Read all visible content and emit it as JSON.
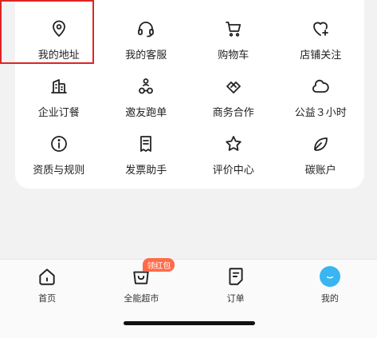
{
  "menu": {
    "items": [
      {
        "label": "我的地址",
        "icon": "location-pin-icon"
      },
      {
        "label": "我的客服",
        "icon": "headset-icon"
      },
      {
        "label": "购物车",
        "icon": "cart-icon"
      },
      {
        "label": "店铺关注",
        "icon": "heart-plus-icon"
      },
      {
        "label": "企业订餐",
        "icon": "building-icon"
      },
      {
        "label": "邀友跑单",
        "icon": "person-bike-icon"
      },
      {
        "label": "商务合作",
        "icon": "handshake-icon"
      },
      {
        "label": "公益３小时",
        "icon": "cloud-icon"
      },
      {
        "label": "资质与规则",
        "icon": "info-icon"
      },
      {
        "label": "发票助手",
        "icon": "receipt-icon"
      },
      {
        "label": "评价中心",
        "icon": "star-icon"
      },
      {
        "label": "碳账户",
        "icon": "leaf-icon"
      }
    ]
  },
  "tabbar": {
    "tabs": [
      {
        "label": "首页",
        "icon": "home-icon"
      },
      {
        "label": "全能超市",
        "icon": "shopping-bag-icon",
        "badge": "领红包"
      },
      {
        "label": "订单",
        "icon": "order-note-icon"
      },
      {
        "label": "我的",
        "icon": "me-face-icon",
        "active": true
      }
    ]
  },
  "colors": {
    "highlight": "#e02424",
    "badge": "#ff6b4a",
    "active_tab": "#39b5f2"
  }
}
